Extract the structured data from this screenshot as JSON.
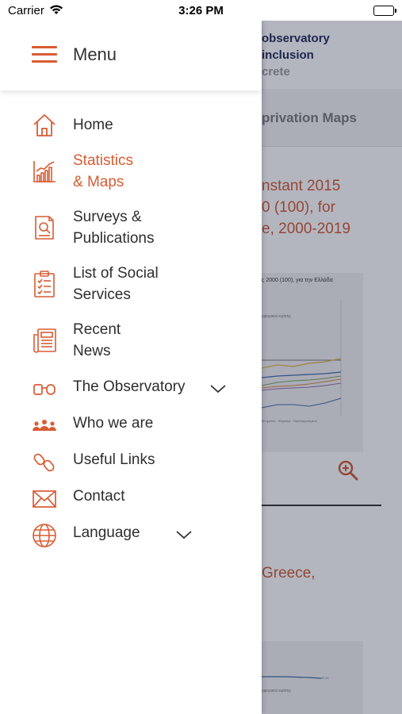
{
  "status_bar": {
    "carrier": "Carrier",
    "time": "3:26 PM"
  },
  "background": {
    "header_line1": "observatory",
    "header_line2": "inclusion",
    "header_line3": "crete",
    "tab": "privation Maps",
    "title": "nstant 2015\n0 (100), for\ne, 2000-2019",
    "figure_caption": "ς 2000 (100), για την Ελλάδα",
    "figure_note": "ρφορικού κρίσης",
    "figure_footer": "Μνημόνια · Ψηφιακά · Προσαρμοσμένη",
    "title2": "Greece,",
    "figure2_label": "90.21",
    "figure2_note": "ρφορικού κρίσης"
  },
  "drawer": {
    "title": "Menu",
    "items": [
      {
        "label": "Home",
        "icon": "home-icon"
      },
      {
        "label": "Statistics\n& Maps",
        "icon": "bar-chart-icon",
        "active": true
      },
      {
        "label": "Surveys &\nPublications",
        "icon": "document-search-icon"
      },
      {
        "label": "List of Social\nServices",
        "icon": "clipboard-checklist-icon"
      },
      {
        "label": "Recent\nNews",
        "icon": "newspaper-icon"
      },
      {
        "label": "The Observatory",
        "icon": "binoculars-icon",
        "expandable": true
      },
      {
        "label": "Who we are",
        "icon": "group-icon"
      },
      {
        "label": "Useful Links",
        "icon": "link-icon"
      },
      {
        "label": "Contact",
        "icon": "envelope-icon"
      },
      {
        "label": "Language",
        "icon": "globe-icon",
        "expandable": true
      }
    ]
  },
  "colors": {
    "accent": "#d85c33",
    "text": "#2e2e2e",
    "overlay": "#1c203c"
  }
}
